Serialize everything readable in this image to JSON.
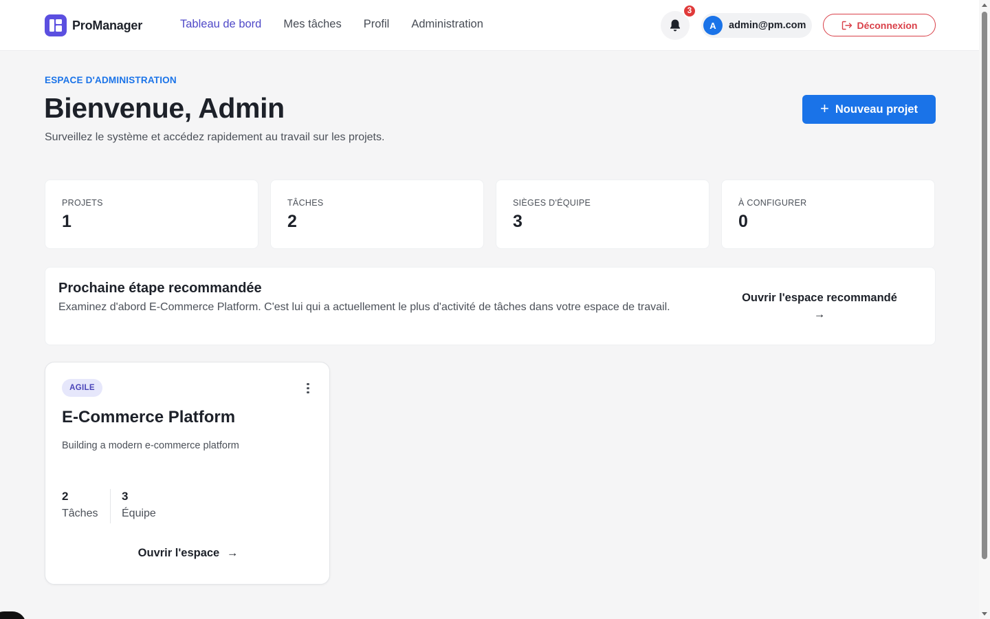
{
  "header": {
    "brand_name": "ProManager",
    "nav": [
      {
        "label": "Tableau de bord",
        "active": true
      },
      {
        "label": "Mes tâches",
        "active": false
      },
      {
        "label": "Profil",
        "active": false
      },
      {
        "label": "Administration",
        "active": false
      }
    ],
    "notifications_count": "3",
    "user_initial": "A",
    "user_email": "admin@pm.com",
    "logout_label": "Déconnexion"
  },
  "hero": {
    "eyebrow": "ESPACE D'ADMINISTRATION",
    "title": "Bienvenue, Admin",
    "subtitle": "Surveillez le système et accédez rapidement au travail sur les projets.",
    "new_project_label": "Nouveau projet"
  },
  "stats": [
    {
      "label": "PROJETS",
      "value": "1"
    },
    {
      "label": "TÂCHES",
      "value": "2"
    },
    {
      "label": "SIÈGES D'ÉQUIPE",
      "value": "3"
    },
    {
      "label": "À CONFIGURER",
      "value": "0"
    }
  ],
  "recommendation": {
    "title": "Prochaine étape recommandée",
    "text": "Examinez d'abord E-Commerce Platform. C'est lui qui a actuellement le plus d'activité de tâches dans votre espace de travail.",
    "link_label": "Ouvrir l'espace recommandé",
    "link_arrow": "→"
  },
  "project": {
    "tag": "AGILE",
    "name": "E-Commerce Platform",
    "description": "Building a modern e-commerce platform",
    "tasks_count": "2",
    "tasks_label": "Tâches",
    "team_count": "3",
    "team_label": "Équipe",
    "open_label": "Ouvrir l'espace",
    "open_arrow": "→"
  },
  "colors": {
    "primary": "#1a73e8",
    "brand": "#5b4fe0",
    "danger": "#d93f48",
    "nav_active": "#4f49c8"
  },
  "icons": [
    "brand-logo-icon",
    "bell-icon",
    "logout-icon",
    "plus-icon",
    "arrow-right-icon",
    "kebab-menu-icon"
  ]
}
